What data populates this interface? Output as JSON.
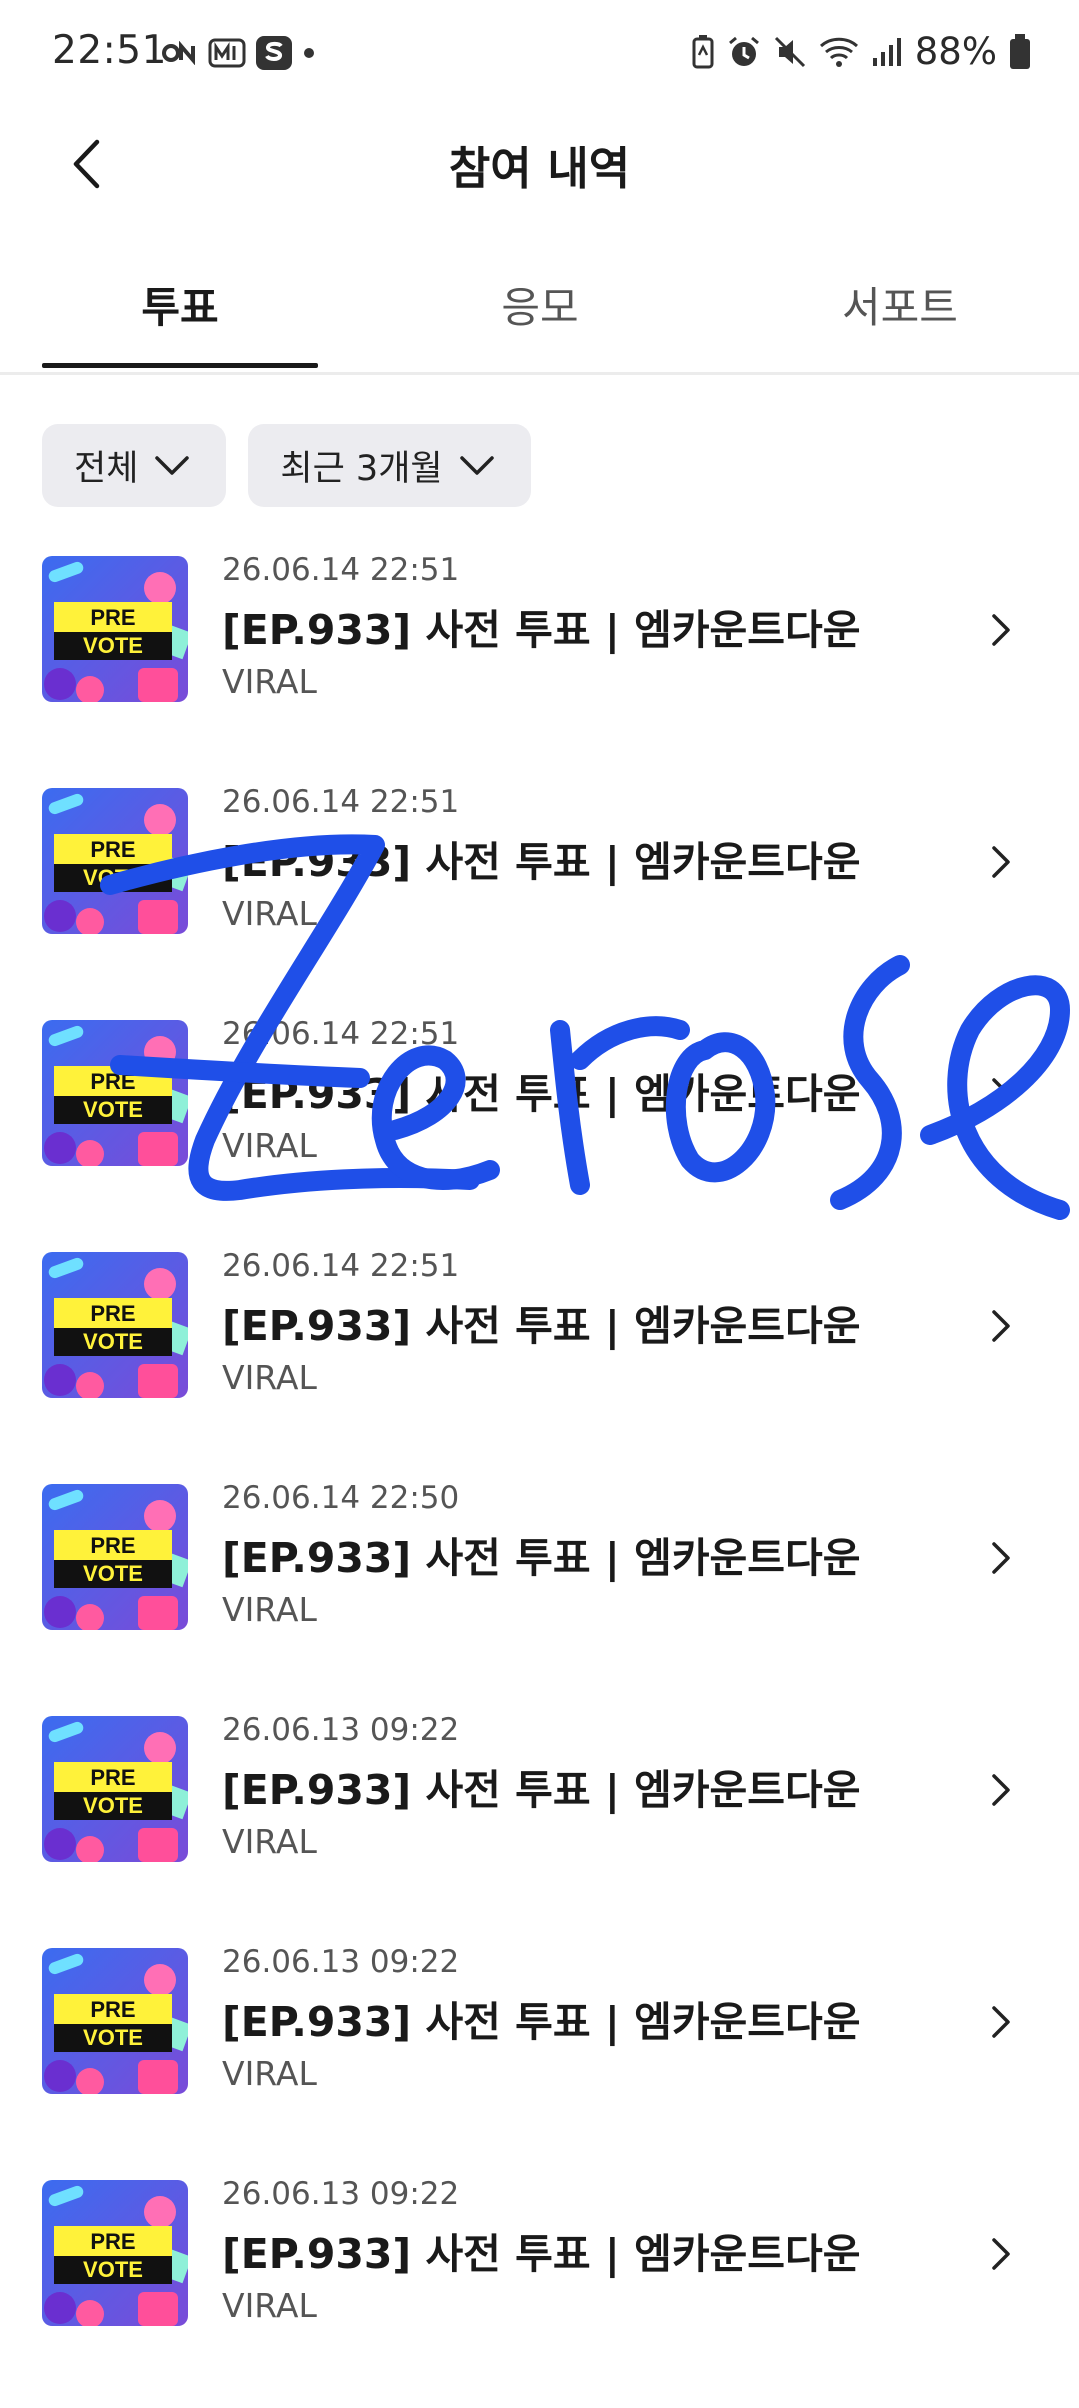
{
  "status_bar": {
    "time": "22:51",
    "left_icons": [
      "on-icon",
      "mnet-icon",
      "s-app-icon",
      "dot-icon"
    ],
    "right_icons": [
      "battery-saver-icon",
      "alarm-icon",
      "mute-icon",
      "wifi-icon",
      "signal-icon",
      "battery-icon"
    ],
    "battery": "88%"
  },
  "header": {
    "title": "참여 내역",
    "back_icon": "chevron-left-icon"
  },
  "tabs": [
    {
      "label": "투표",
      "active": true
    },
    {
      "label": "응모",
      "active": false
    },
    {
      "label": "서포트",
      "active": false
    }
  ],
  "filters": [
    {
      "label": "전체",
      "icon": "chevron-down-icon"
    },
    {
      "label": "최근 3개월",
      "icon": "chevron-down-icon"
    }
  ],
  "thumbnail_text": {
    "line1": "PRE",
    "line2": "VOTE"
  },
  "items": [
    {
      "date": "26.06.14 22:51",
      "title": "[EP.933] 사전 투표 | 엠카운트다운",
      "subtitle": "VIRAL"
    },
    {
      "date": "26.06.14 22:51",
      "title": "[EP.933] 사전 투표 | 엠카운트다운",
      "subtitle": "VIRAL"
    },
    {
      "date": "26.06.14 22:51",
      "title": "[EP.933] 사전 투표 | 엠카운트다운",
      "subtitle": "VIRAL"
    },
    {
      "date": "26.06.14 22:51",
      "title": "[EP.933] 사전 투표 | 엠카운트다운",
      "subtitle": "VIRAL"
    },
    {
      "date": "26.06.14 22:50",
      "title": "[EP.933] 사전 투표 | 엠카운트다운",
      "subtitle": "VIRAL"
    },
    {
      "date": "26.06.13 09:22",
      "title": "[EP.933] 사전 투표 | 엠카운트다운",
      "subtitle": "VIRAL"
    },
    {
      "date": "26.06.13 09:22",
      "title": "[EP.933] 사전 투표 | 엠카운트다운",
      "subtitle": "VIRAL"
    },
    {
      "date": "26.06.13 09:22",
      "title": "[EP.933] 사전 투표 | 엠카운트다운",
      "subtitle": "VIRAL"
    }
  ],
  "overlay": {
    "signature_text": "Zerose",
    "color": "#1f4fe8"
  },
  "colors": {
    "accent": "#1a1a1a",
    "chip_bg": "#ececf0",
    "divider": "#ececec"
  }
}
